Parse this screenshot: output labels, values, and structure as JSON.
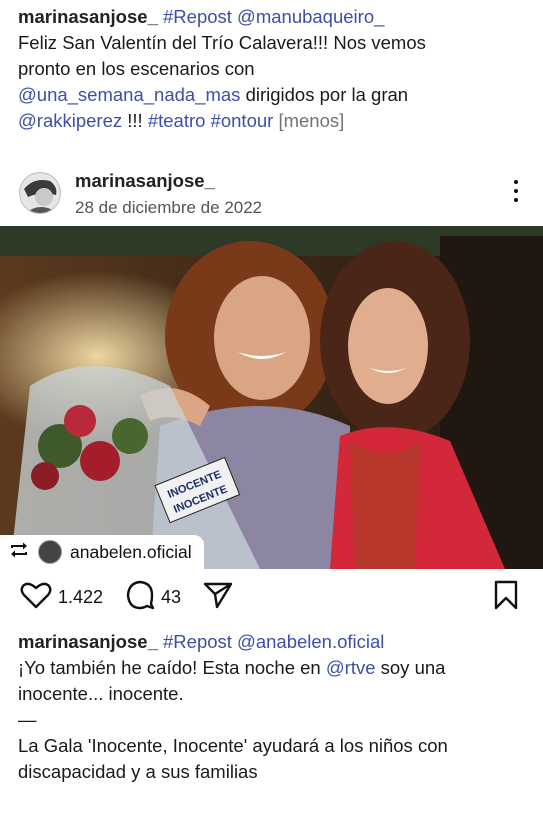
{
  "top_caption": {
    "username": "marinasanjose_",
    "repost_tag": "#Repost",
    "repost_user": "@manubaqueiro_",
    "line1": "Feliz San Valentín del Trío Calavera!!! Nos vemos",
    "line2": "pronto en los escenarios con",
    "mention1": "@una_semana_nada_mas",
    "line3_rest": " dirigidos por la gran",
    "mention2": "@rakkiperez",
    "line4_mid": " !!! ",
    "hashtags": "#teatro #ontour",
    "more": "[menos]"
  },
  "post_header": {
    "username": "marinasanjose_",
    "date": "28 de diciembre de 2022",
    "avatar_icon": "avatar",
    "menu_icon": "more-options-icon"
  },
  "photo": {
    "sign_text_1": "INOCENTE",
    "sign_text_2": "INOCENTE",
    "colors": {
      "background": "#3a2a1c",
      "shirt_left": "#8c86a2",
      "cardigan_right": "#d2283a"
    }
  },
  "repost_badge": {
    "icon": "repost-icon",
    "account": "anabelen.oficial"
  },
  "actions": {
    "likes": "1.422",
    "comments": "43"
  },
  "bottom_caption": {
    "username": "marinasanjose_",
    "repost_tag": "#Repost",
    "repost_user": "@anabelen.oficial",
    "line1": "¡Yo también he caído! Esta noche en ",
    "mention": "@rtve",
    "line1_rest": " soy una",
    "line2": "inocente... inocente.",
    "dash": "—",
    "line3": "La Gala 'Inocente, Inocente' ayudará a los niños con",
    "line4": "discapacidad y a sus familias"
  },
  "accent_colors": {
    "link": "#3d4fa8",
    "text": "#1a1a1a",
    "muted": "#737373"
  }
}
